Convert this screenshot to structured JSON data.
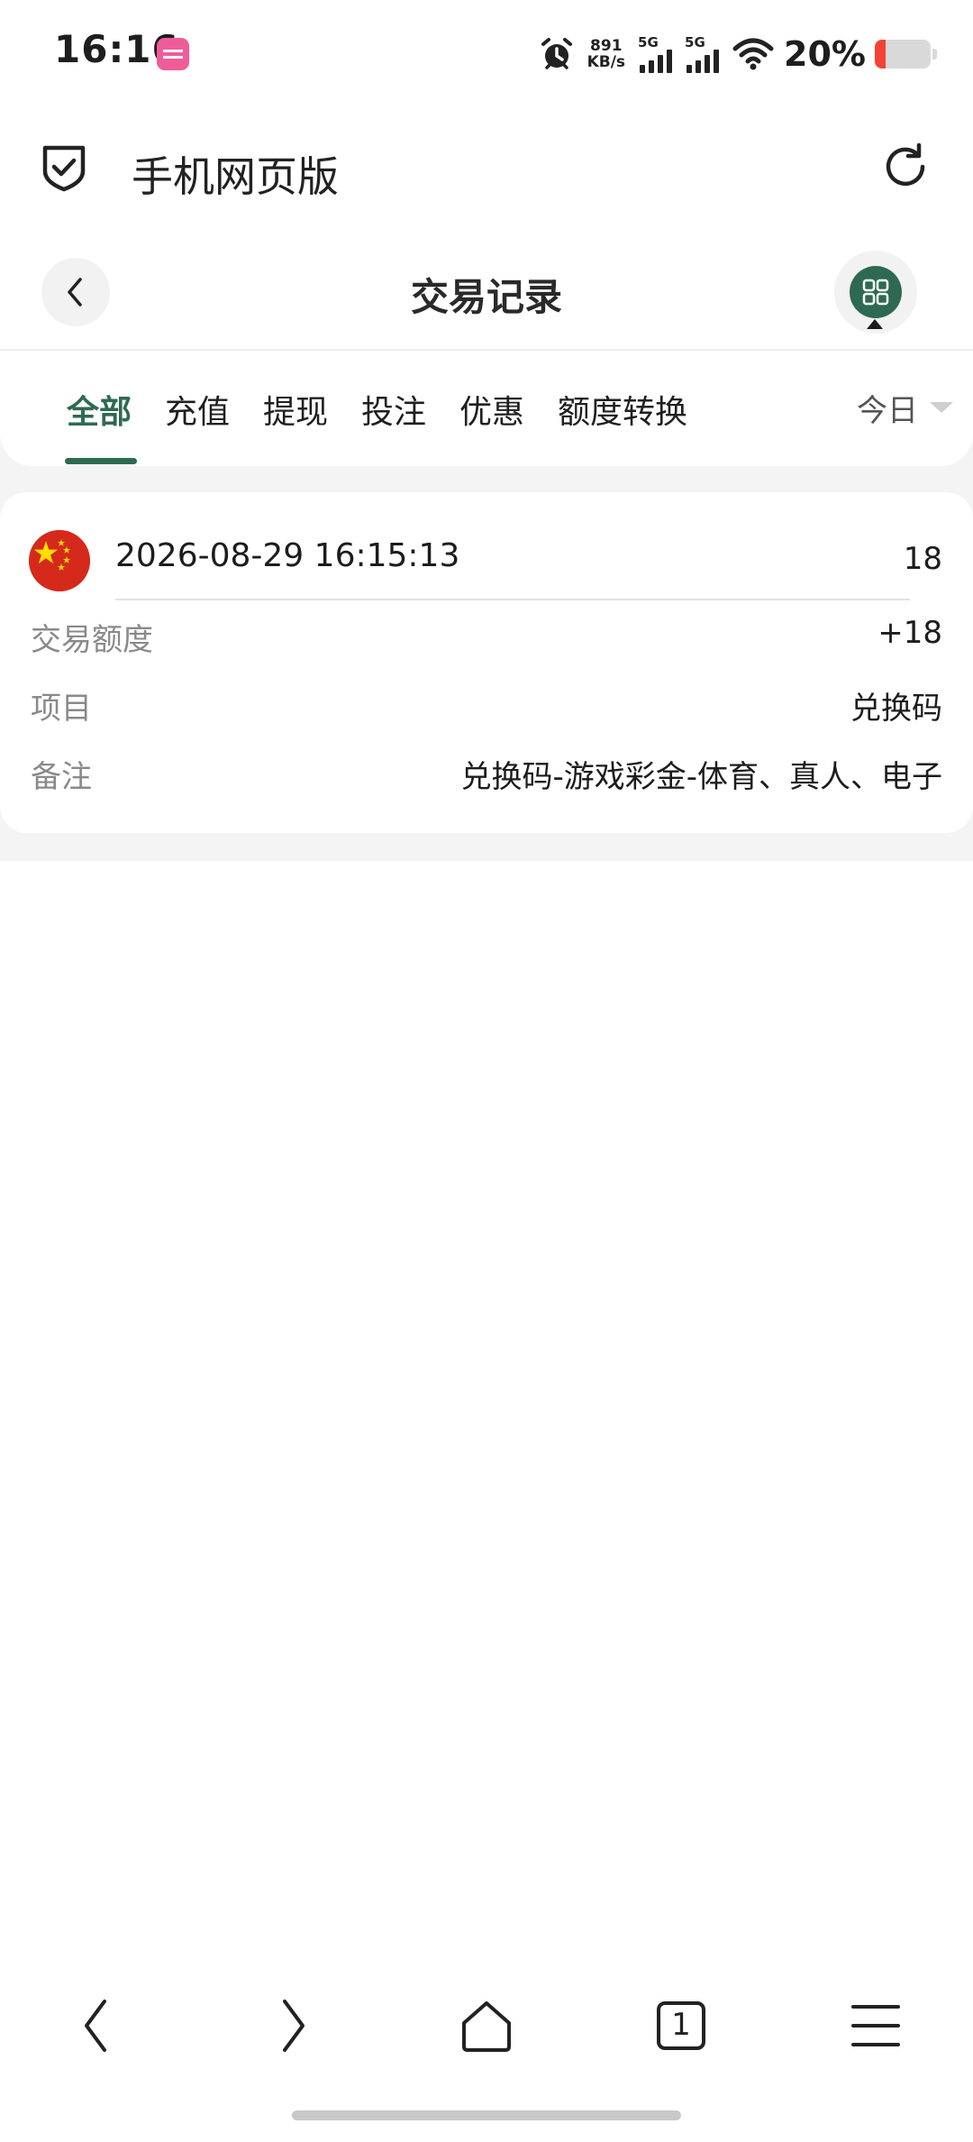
{
  "status_bar": {
    "time": "16:16",
    "net_speed_value": "891",
    "net_speed_unit": "KB/s",
    "sim1_label": "5G",
    "sim2_label": "5G",
    "battery_percent": "20%",
    "battery_level": 0.2,
    "icons": [
      "app-notification-icon",
      "alarm-icon",
      "signal-icon",
      "signal-icon",
      "wifi-icon",
      "battery-icon"
    ]
  },
  "browser": {
    "title": "手机网页版",
    "icons": [
      "shield-check-icon",
      "refresh-icon"
    ]
  },
  "page": {
    "title": "交易记录"
  },
  "tabs": [
    {
      "label": "全部",
      "active": true
    },
    {
      "label": "充值",
      "active": false
    },
    {
      "label": "提现",
      "active": false
    },
    {
      "label": "投注",
      "active": false
    },
    {
      "label": "优惠",
      "active": false
    },
    {
      "label": "额度转换",
      "active": false
    }
  ],
  "date_filter": {
    "label": "今日"
  },
  "record": {
    "time": "2026-08-29 16:15:13",
    "number": "18",
    "rows": [
      {
        "label": "交易额度",
        "value": "+18"
      },
      {
        "label": "项目",
        "value": "兑换码"
      },
      {
        "label": "备注",
        "value": "兑换码-游戏彩金-体育、真人、电子"
      }
    ]
  },
  "bottom_nav": {
    "tab_count": "1",
    "icons": [
      "back-arrow-icon",
      "forward-arrow-icon",
      "home-icon",
      "tabs-icon",
      "menu-icon"
    ]
  },
  "colors": {
    "accent": "#2e6a52",
    "background_gray": "#f4f4f4"
  }
}
